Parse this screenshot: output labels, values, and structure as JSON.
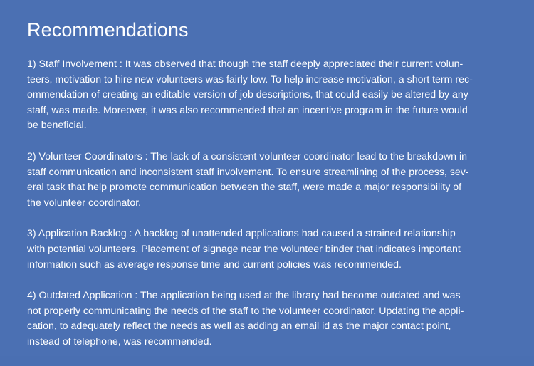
{
  "title": "Recommendations",
  "paragraphs": [
    {
      "lines": [
        "1) Staff Involvement : It was observed that though the staff deeply appreciated their current volun-",
        "teers, motivation to hire new volunteers was fairly low. To help increase motivation, a short term rec-",
        "ommendation of creating an editable version of job descriptions, that could easily be altered by any",
        "staff, was made. Moreover, it was also recommended that an incentive program in the future would",
        "be beneficial."
      ]
    },
    {
      "lines": [
        "2) Volunteer Coordinators : The lack of a consistent volunteer coordinator lead to the breakdown in",
        "staff communication and inconsistent staff involvement.  To ensure streamlining of the process, sev-",
        "eral task that help promote communication between the staff, were made a major responsibility of",
        "the volunteer coordinator."
      ]
    },
    {
      "lines": [
        "3) Application Backlog : A backlog of unattended applications had caused a strained relationship",
        "with potential volunteers. Placement of signage near the volunteer binder that indicates important",
        "information such as average response time and current policies was recommended."
      ]
    },
    {
      "lines": [
        "4) Outdated Application : The application being used at the library had become outdated and was",
        "not properly communicating the needs of the staff to the volunteer coordinator. Updating the appli-",
        "cation, to adequately reflect the needs as well as adding an email id as the major contact point,",
        "instead of telephone, was recommended."
      ]
    }
  ]
}
